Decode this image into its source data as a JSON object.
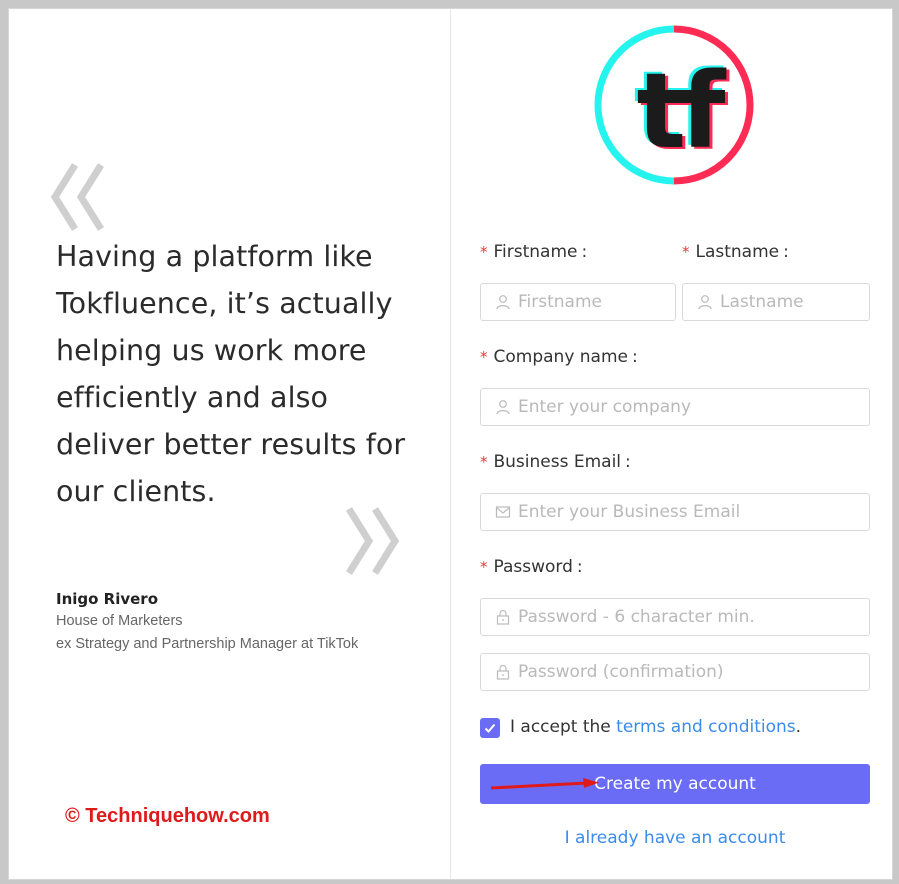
{
  "testimonial": {
    "quote": "Having a platform like Tokfluence, it’s actually helping us work more efficiently and also deliver better results for our clients.",
    "author_name": "Inigo Rivero",
    "author_org": "House of Marketers",
    "author_role": "ex Strategy and Partnership Manager at TikTok",
    "quote_open_icon": "double-chevron-left-icon",
    "quote_close_icon": "double-chevron-right-icon"
  },
  "watermark": "© Techniquehow.com",
  "logo": {
    "text": "tf",
    "ring_colors": [
      "#25F4EE",
      "#FE2C55"
    ]
  },
  "form": {
    "required_mark": "*",
    "colon": ":",
    "firstname": {
      "label": "Firstname",
      "placeholder": "Firstname",
      "value": "",
      "icon": "user-icon"
    },
    "lastname": {
      "label": "Lastname",
      "placeholder": "Lastname",
      "value": "",
      "icon": "user-icon"
    },
    "company": {
      "label": "Company name",
      "placeholder": "Enter your company",
      "value": "",
      "icon": "user-icon"
    },
    "email": {
      "label": "Business Email",
      "placeholder": "Enter your Business Email",
      "value": "",
      "icon": "mail-icon"
    },
    "password": {
      "label": "Password",
      "placeholder": "Password - 6 character min.",
      "value": "",
      "icon": "lock-icon"
    },
    "password_confirm": {
      "placeholder": "Password (confirmation)",
      "value": "",
      "icon": "lock-icon"
    },
    "accept": {
      "checked": true,
      "prefix": "I accept the ",
      "link": "terms and conditions",
      "suffix": "."
    },
    "submit_label": "Create my account",
    "login_link": "I already have an account"
  },
  "colors": {
    "accent": "#6a6cf6",
    "link": "#3b8beb",
    "required": "#e5383b",
    "watermark": "#e01a1a",
    "annotation_arrow": "#e01a1a"
  }
}
